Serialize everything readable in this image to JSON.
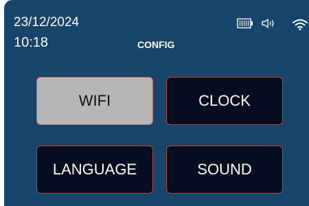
{
  "status_bar": {
    "date": "23/12/2024",
    "time": "10:18",
    "icons": [
      "battery-icon",
      "speaker-icon",
      "wifi-icon"
    ]
  },
  "header": {
    "title": "CONFIG"
  },
  "menu": {
    "items": [
      {
        "label": "WIFI",
        "selected": true
      },
      {
        "label": "CLOCK",
        "selected": false
      },
      {
        "label": "LANGUAGE",
        "selected": false
      },
      {
        "label": "SOUND",
        "selected": false
      }
    ]
  },
  "colors": {
    "screen_bg": "#17446a",
    "tile_bg": "#050e1e",
    "tile_border": "#b5473a",
    "selected_bg": "#b6b6b6",
    "text": "#ffffff"
  }
}
